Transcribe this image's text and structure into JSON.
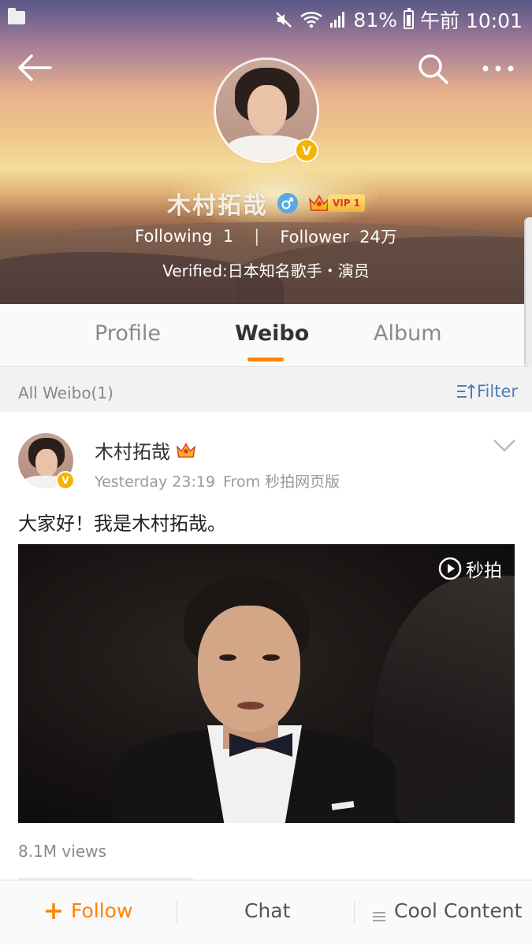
{
  "status_bar": {
    "battery": "81%",
    "time": "午前 10:01"
  },
  "profile": {
    "name": "木村拓哉",
    "vip_label": "VIP 1",
    "verified_badge": "V",
    "following_label": "Following",
    "following_count": "1",
    "stats_separator": "|",
    "follower_label": "Follower",
    "follower_count": "24万",
    "verified_text": "Verified:日本知名歌手・演员"
  },
  "tabs": [
    {
      "label": "Profile"
    },
    {
      "label": "Weibo"
    },
    {
      "label": "Album"
    }
  ],
  "filter_bar": {
    "all_label": "All Weibo(1)",
    "filter_label": "Filter"
  },
  "post": {
    "author": "木村拓哉",
    "badge": "V",
    "time": "Yesterday 23:19",
    "source": "From 秒拍网页版",
    "text": "大家好！我是木村拓哉。",
    "video_logo": "秒拍",
    "views": "8.1M views"
  },
  "bottom_bar": {
    "follow_label": "Follow",
    "chat_label": "Chat",
    "cool_label": "Cool Content"
  },
  "colors": {
    "accent": "#ff8200",
    "link": "#4a7fb8",
    "verified": "#f4b400"
  }
}
